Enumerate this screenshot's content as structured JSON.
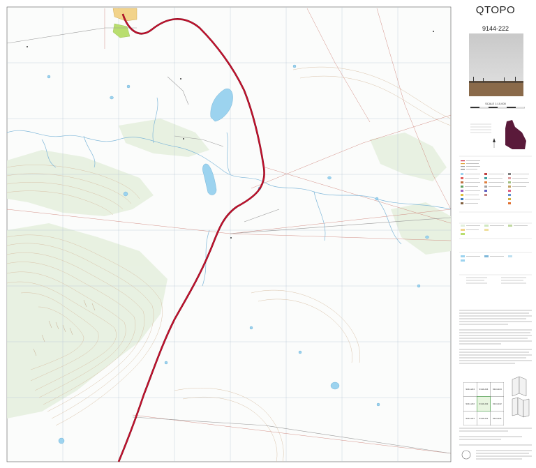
{
  "map": {
    "title": "QTOPO",
    "sheet_number": "9144-222",
    "scale": "SCALE 1:10,000",
    "index_sheets": [
      "9144-224",
      "9144-224",
      "9144-224",
      "9144-222",
      "9144-222",
      "9144-222",
      "9144-221",
      "9144-221",
      "9144-221"
    ],
    "colors": {
      "road_primary": "#c8102e",
      "road_outline": "#7a0a1a",
      "water": "#9cd3ef",
      "contour": "#d9c2a8",
      "vegetation": "#e3efdc",
      "boundary": "#c9746a",
      "grid": "#b8c6d6",
      "urban": "#f2d38a",
      "lot": "#b9de6f"
    }
  }
}
